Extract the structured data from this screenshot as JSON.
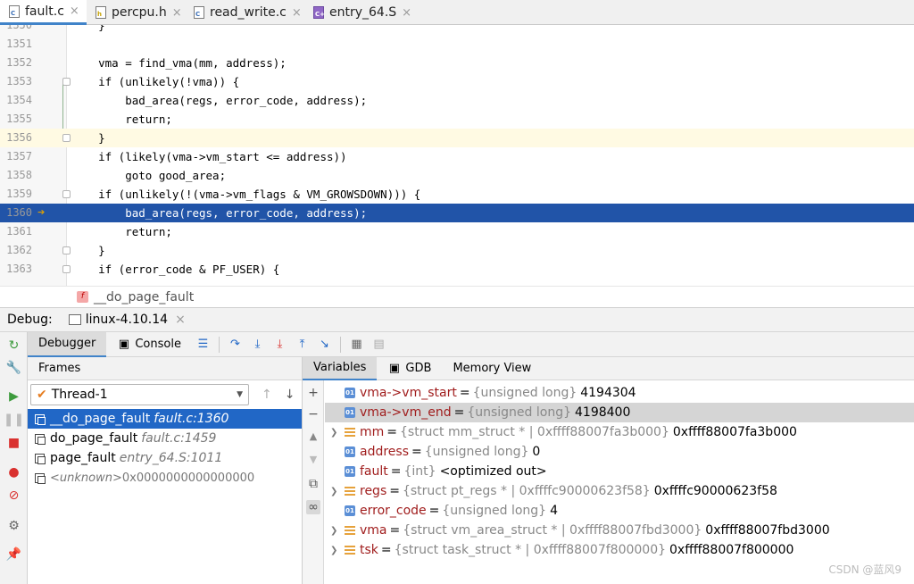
{
  "tabs": [
    {
      "label": "fault.c",
      "type": "c"
    },
    {
      "label": "percpu.h",
      "type": "h"
    },
    {
      "label": "read_write.c",
      "type": "c"
    },
    {
      "label": "entry_64.S",
      "type": "s"
    }
  ],
  "tab_close_glyph": "×",
  "code_lines": [
    {
      "num": "1350",
      "text": "    }"
    },
    {
      "num": "1351",
      "text": ""
    },
    {
      "num": "1352",
      "text": "    vma = find_vma(mm, address);"
    },
    {
      "num": "1353",
      "text": "    if (unlikely(!vma)) {"
    },
    {
      "num": "1354",
      "text": "        bad_area(regs, error_code, address);"
    },
    {
      "num": "1355",
      "text": "        return;"
    },
    {
      "num": "1356",
      "text": "    }"
    },
    {
      "num": "1357",
      "text": "    if (likely(vma->vm_start <= address))"
    },
    {
      "num": "1358",
      "text": "        goto good_area;"
    },
    {
      "num": "1359",
      "text": "    if (unlikely(!(vma->vm_flags & VM_GROWSDOWN))) {"
    },
    {
      "num": "1360",
      "text": "        bad_area(regs, error_code, address);"
    },
    {
      "num": "1361",
      "text": "        return;"
    },
    {
      "num": "1362",
      "text": "    }"
    },
    {
      "num": "1363",
      "text": "    if (error_code & PF_USER) {"
    }
  ],
  "breadcrumb": {
    "badge": "f",
    "label": "__do_page_fault"
  },
  "debug": {
    "title": "Debug:",
    "session": "linux-4.10.14"
  },
  "toolbar": {
    "debugger_tab": "Debugger",
    "console_tab": "Console"
  },
  "frames": {
    "header": "Frames",
    "thread": "Thread-1",
    "items": [
      {
        "fn": "__do_page_fault",
        "loc": "fault.c:1360"
      },
      {
        "fn": "do_page_fault",
        "loc": "fault.c:1459"
      },
      {
        "fn": "page_fault",
        "loc": "entry_64.S:1011"
      },
      {
        "fn": "<unknown>",
        "loc": "0x0000000000000000"
      }
    ]
  },
  "variables": {
    "tabs": [
      "Variables",
      "GDB",
      "Memory View"
    ],
    "items": [
      {
        "name": "vma->vm_start",
        "type": "{unsigned long}",
        "value": "4194304",
        "kind": "prim"
      },
      {
        "name": "vma->vm_end",
        "type": "{unsigned long}",
        "value": "4198400",
        "kind": "prim"
      },
      {
        "name": "mm",
        "type": "{struct mm_struct * | 0xffff88007fa3b000}",
        "value": "0xffff88007fa3b000",
        "kind": "obj"
      },
      {
        "name": "address",
        "type": "{unsigned long}",
        "value": "0",
        "kind": "prim"
      },
      {
        "name": "fault",
        "type": "{int}",
        "value": "<optimized out>",
        "kind": "prim"
      },
      {
        "name": "regs",
        "type": "{struct pt_regs * | 0xffffc90000623f58}",
        "value": "0xffffc90000623f58",
        "kind": "obj"
      },
      {
        "name": "error_code",
        "type": "{unsigned long}",
        "value": "4",
        "kind": "prim"
      },
      {
        "name": "vma",
        "type": "{struct vm_area_struct * | 0xffff88007fbd3000}",
        "value": "0xffff88007fbd3000",
        "kind": "obj"
      },
      {
        "name": "tsk",
        "type": "{struct task_struct * | 0xffff88007f800000}",
        "value": "0xffff88007f800000",
        "kind": "obj"
      }
    ]
  },
  "watermark": "CSDN @蓝风9",
  "colors": {
    "accent": "#4083c9",
    "exec_line": "#2154a8",
    "selection": "#2167c6",
    "var_name": "#a01d1d"
  }
}
